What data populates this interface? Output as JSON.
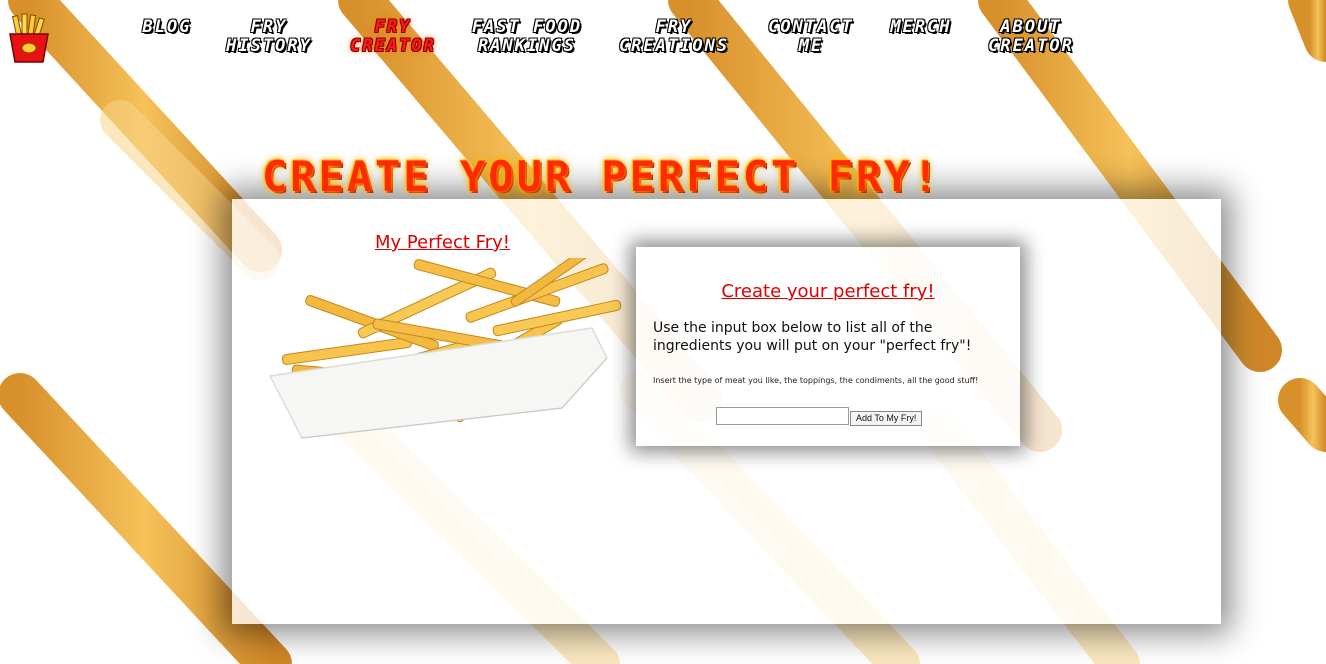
{
  "nav": {
    "items": [
      {
        "line1": "BLOG",
        "line2": ""
      },
      {
        "line1": "FRY",
        "line2": "HISTORY"
      },
      {
        "line1": "FRY",
        "line2": "CREATOR"
      },
      {
        "line1": "FAST FOOD",
        "line2": "RANKINGS"
      },
      {
        "line1": "FRY",
        "line2": "CREATIONS"
      },
      {
        "line1": "CONTACT",
        "line2": "ME"
      },
      {
        "line1": "MERCH",
        "line2": ""
      },
      {
        "line1": "ABOUT",
        "line2": "CREATOR"
      }
    ],
    "active_index": 2
  },
  "headline": "CREATE YOUR PERFECT FRY!",
  "left_panel": {
    "title": "My Perfect Fry!",
    "image_icon": "fries-in-paper-tray"
  },
  "form": {
    "title": "Create your perfect fry!",
    "instructions": "Use the input box below to list all of the ingredients you will put on your \"perfect fry\"!",
    "hint": "Insert the type of meat you like, the toppings, the condiments, all the good stuff!",
    "input_value": "",
    "input_placeholder": "",
    "button_label": "Add To My Fry!"
  },
  "colors": {
    "accent_red": "#e00000",
    "headline_red": "#ff2a00",
    "fry_gold": "#f4b33a"
  },
  "logo_icon": "fries-box-logo"
}
